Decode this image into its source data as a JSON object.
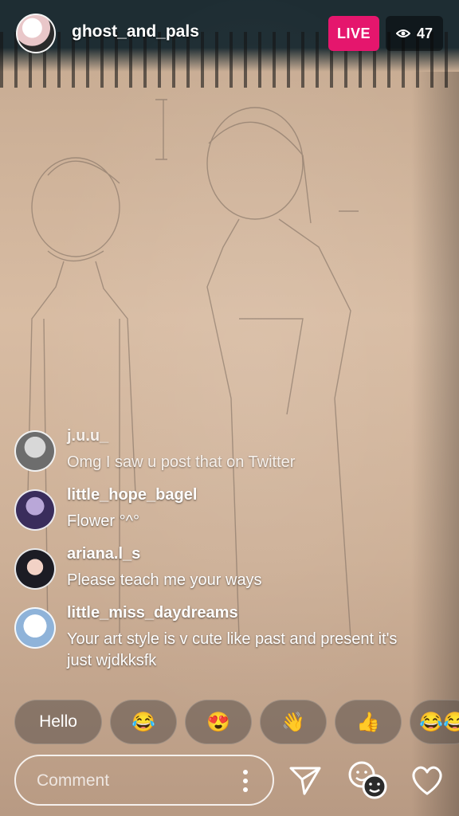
{
  "header": {
    "host_username": "ghost_and_pals",
    "live_label": "LIVE",
    "viewer_count": "47"
  },
  "comments": [
    {
      "username": "j.u.u_",
      "text": "Omg I saw u post that on Twitter"
    },
    {
      "username": "little_hope_bagel",
      "text": "Flower °^°"
    },
    {
      "username": "ariana.l_s",
      "text": "Please teach me your ways"
    },
    {
      "username": "little_miss_daydreams",
      "text": "Your art style is v cute like past and present it's just wjdkksfk"
    }
  ],
  "quick_reactions": [
    "Hello",
    "😂",
    "😍",
    "👋",
    "👍",
    "😂😂"
  ],
  "composer": {
    "placeholder": "Comment"
  },
  "icons": {
    "more": "more-vertical-icon",
    "send": "send-icon",
    "faces": "faces-icon",
    "like": "heart-icon",
    "viewers": "eye-icon"
  },
  "colors": {
    "live": "#e5166d",
    "text": "#ffffff"
  }
}
